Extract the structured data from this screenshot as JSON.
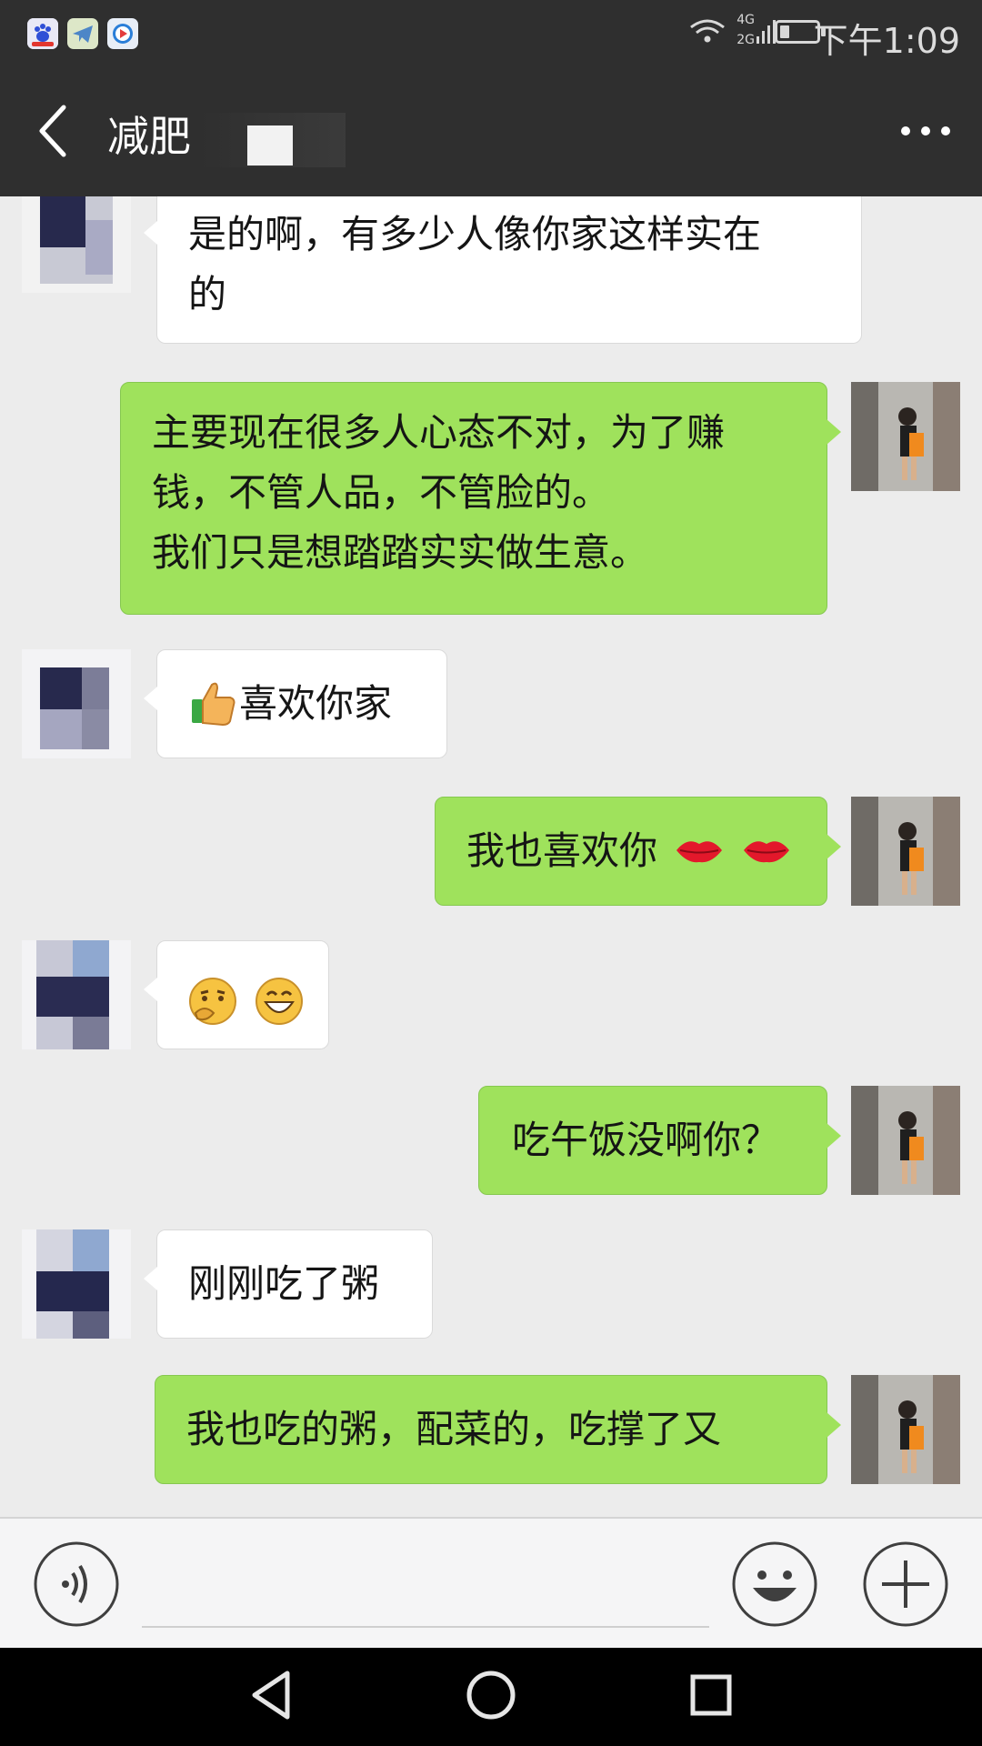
{
  "status_bar": {
    "time": "下午1:09",
    "network_top": "4G",
    "network_bottom": "2G",
    "battery_level": 0.25,
    "app_icons": [
      "baidu-icon",
      "telegram-icon",
      "video-icon"
    ]
  },
  "header": {
    "title": "减肥",
    "back_icon": "back-arrow-icon",
    "more_icon": "more-icon"
  },
  "messages": [
    {
      "side": "in",
      "text_lines": [
        "是的啊，有多少人像你家这样实在",
        "的"
      ]
    },
    {
      "side": "out",
      "text_lines": [
        "主要现在很多人心态不对，为了赚",
        "钱，不管人品，不管脸的。",
        "我们只是想踏踏实实做生意。"
      ]
    },
    {
      "side": "in",
      "text": "喜欢你家",
      "emoji": "thumbs-up-icon"
    },
    {
      "side": "out",
      "text": "我也喜欢你",
      "emojis": [
        "lips-icon",
        "lips-icon"
      ]
    },
    {
      "side": "in",
      "emojis": [
        "thinking-face-icon",
        "grinning-face-icon"
      ]
    },
    {
      "side": "out",
      "text": "吃午饭没啊你？"
    },
    {
      "side": "in",
      "text": "刚刚吃了粥"
    },
    {
      "side": "out",
      "text": "我也吃的粥，配菜的，吃撑了又"
    }
  ],
  "input_bar": {
    "voice_icon": "voice-icon",
    "emoji_icon": "emoji-icon",
    "plus_icon": "plus-icon"
  },
  "system_nav": {
    "back_icon": "back-triangle-icon",
    "home_icon": "home-circle-icon",
    "recents_icon": "recents-square-icon"
  },
  "colors": {
    "bar_bg": "#2f2f2f",
    "chat_bg": "#ececec",
    "bubble_out": "#9fe25c",
    "bubble_in": "#ffffff"
  }
}
